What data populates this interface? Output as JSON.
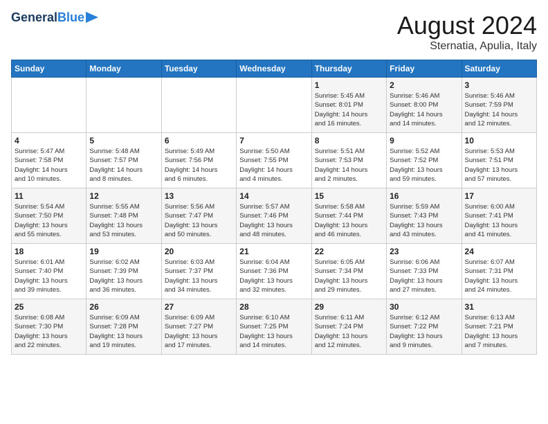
{
  "header": {
    "logo_line1": "General",
    "logo_line2": "Blue",
    "month_year": "August 2024",
    "location": "Sternatia, Apulia, Italy"
  },
  "weekdays": [
    "Sunday",
    "Monday",
    "Tuesday",
    "Wednesday",
    "Thursday",
    "Friday",
    "Saturday"
  ],
  "weeks": [
    [
      {
        "day": "",
        "info": ""
      },
      {
        "day": "",
        "info": ""
      },
      {
        "day": "",
        "info": ""
      },
      {
        "day": "",
        "info": ""
      },
      {
        "day": "1",
        "info": "Sunrise: 5:45 AM\nSunset: 8:01 PM\nDaylight: 14 hours\nand 16 minutes."
      },
      {
        "day": "2",
        "info": "Sunrise: 5:46 AM\nSunset: 8:00 PM\nDaylight: 14 hours\nand 14 minutes."
      },
      {
        "day": "3",
        "info": "Sunrise: 5:46 AM\nSunset: 7:59 PM\nDaylight: 14 hours\nand 12 minutes."
      }
    ],
    [
      {
        "day": "4",
        "info": "Sunrise: 5:47 AM\nSunset: 7:58 PM\nDaylight: 14 hours\nand 10 minutes."
      },
      {
        "day": "5",
        "info": "Sunrise: 5:48 AM\nSunset: 7:57 PM\nDaylight: 14 hours\nand 8 minutes."
      },
      {
        "day": "6",
        "info": "Sunrise: 5:49 AM\nSunset: 7:56 PM\nDaylight: 14 hours\nand 6 minutes."
      },
      {
        "day": "7",
        "info": "Sunrise: 5:50 AM\nSunset: 7:55 PM\nDaylight: 14 hours\nand 4 minutes."
      },
      {
        "day": "8",
        "info": "Sunrise: 5:51 AM\nSunset: 7:53 PM\nDaylight: 14 hours\nand 2 minutes."
      },
      {
        "day": "9",
        "info": "Sunrise: 5:52 AM\nSunset: 7:52 PM\nDaylight: 13 hours\nand 59 minutes."
      },
      {
        "day": "10",
        "info": "Sunrise: 5:53 AM\nSunset: 7:51 PM\nDaylight: 13 hours\nand 57 minutes."
      }
    ],
    [
      {
        "day": "11",
        "info": "Sunrise: 5:54 AM\nSunset: 7:50 PM\nDaylight: 13 hours\nand 55 minutes."
      },
      {
        "day": "12",
        "info": "Sunrise: 5:55 AM\nSunset: 7:48 PM\nDaylight: 13 hours\nand 53 minutes."
      },
      {
        "day": "13",
        "info": "Sunrise: 5:56 AM\nSunset: 7:47 PM\nDaylight: 13 hours\nand 50 minutes."
      },
      {
        "day": "14",
        "info": "Sunrise: 5:57 AM\nSunset: 7:46 PM\nDaylight: 13 hours\nand 48 minutes."
      },
      {
        "day": "15",
        "info": "Sunrise: 5:58 AM\nSunset: 7:44 PM\nDaylight: 13 hours\nand 46 minutes."
      },
      {
        "day": "16",
        "info": "Sunrise: 5:59 AM\nSunset: 7:43 PM\nDaylight: 13 hours\nand 43 minutes."
      },
      {
        "day": "17",
        "info": "Sunrise: 6:00 AM\nSunset: 7:41 PM\nDaylight: 13 hours\nand 41 minutes."
      }
    ],
    [
      {
        "day": "18",
        "info": "Sunrise: 6:01 AM\nSunset: 7:40 PM\nDaylight: 13 hours\nand 39 minutes."
      },
      {
        "day": "19",
        "info": "Sunrise: 6:02 AM\nSunset: 7:39 PM\nDaylight: 13 hours\nand 36 minutes."
      },
      {
        "day": "20",
        "info": "Sunrise: 6:03 AM\nSunset: 7:37 PM\nDaylight: 13 hours\nand 34 minutes."
      },
      {
        "day": "21",
        "info": "Sunrise: 6:04 AM\nSunset: 7:36 PM\nDaylight: 13 hours\nand 32 minutes."
      },
      {
        "day": "22",
        "info": "Sunrise: 6:05 AM\nSunset: 7:34 PM\nDaylight: 13 hours\nand 29 minutes."
      },
      {
        "day": "23",
        "info": "Sunrise: 6:06 AM\nSunset: 7:33 PM\nDaylight: 13 hours\nand 27 minutes."
      },
      {
        "day": "24",
        "info": "Sunrise: 6:07 AM\nSunset: 7:31 PM\nDaylight: 13 hours\nand 24 minutes."
      }
    ],
    [
      {
        "day": "25",
        "info": "Sunrise: 6:08 AM\nSunset: 7:30 PM\nDaylight: 13 hours\nand 22 minutes."
      },
      {
        "day": "26",
        "info": "Sunrise: 6:09 AM\nSunset: 7:28 PM\nDaylight: 13 hours\nand 19 minutes."
      },
      {
        "day": "27",
        "info": "Sunrise: 6:09 AM\nSunset: 7:27 PM\nDaylight: 13 hours\nand 17 minutes."
      },
      {
        "day": "28",
        "info": "Sunrise: 6:10 AM\nSunset: 7:25 PM\nDaylight: 13 hours\nand 14 minutes."
      },
      {
        "day": "29",
        "info": "Sunrise: 6:11 AM\nSunset: 7:24 PM\nDaylight: 13 hours\nand 12 minutes."
      },
      {
        "day": "30",
        "info": "Sunrise: 6:12 AM\nSunset: 7:22 PM\nDaylight: 13 hours\nand 9 minutes."
      },
      {
        "day": "31",
        "info": "Sunrise: 6:13 AM\nSunset: 7:21 PM\nDaylight: 13 hours\nand 7 minutes."
      }
    ]
  ]
}
